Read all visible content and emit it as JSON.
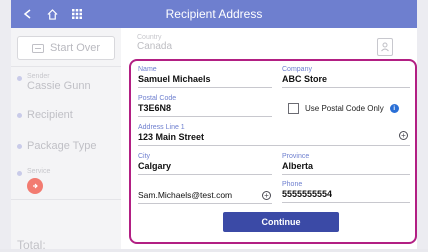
{
  "header": {
    "title": "Recipient Address",
    "back_icon": "back-icon",
    "home_icon": "home-icon",
    "grid_icon": "grid-icon"
  },
  "sidebar": {
    "start_over": "Start Over",
    "steps": [
      {
        "small": "Sender",
        "label": "Cassie Gunn"
      },
      {
        "small": "",
        "label": "Recipient"
      },
      {
        "small": "",
        "label": "Package Type"
      },
      {
        "small": "Service",
        "label": ""
      }
    ],
    "total_label": "Total:"
  },
  "background": {
    "country_label": "Country",
    "country_value": "Canada"
  },
  "form": {
    "name_label": "Name",
    "name_value": "Samuel Michaels",
    "company_label": "Company",
    "company_value": "ABC Store",
    "postal_label": "Postal Code",
    "postal_value": "T3E6N8",
    "postal_only_label": "Use Postal Code Only",
    "address1_label": "Address Line 1",
    "address1_value": "123 Main Street",
    "city_label": "City",
    "city_value": "Calgary",
    "province_label": "Province",
    "province_value": "Alberta",
    "email_value": "Sam.Michaels@test.com",
    "phone_label": "Phone",
    "phone_value": "5555555554",
    "continue_label": "Continue"
  },
  "colors": {
    "header": "#6e7fcf",
    "card_border": "#b21f83",
    "button": "#3b4aa6",
    "label": "#6e7fcf"
  }
}
